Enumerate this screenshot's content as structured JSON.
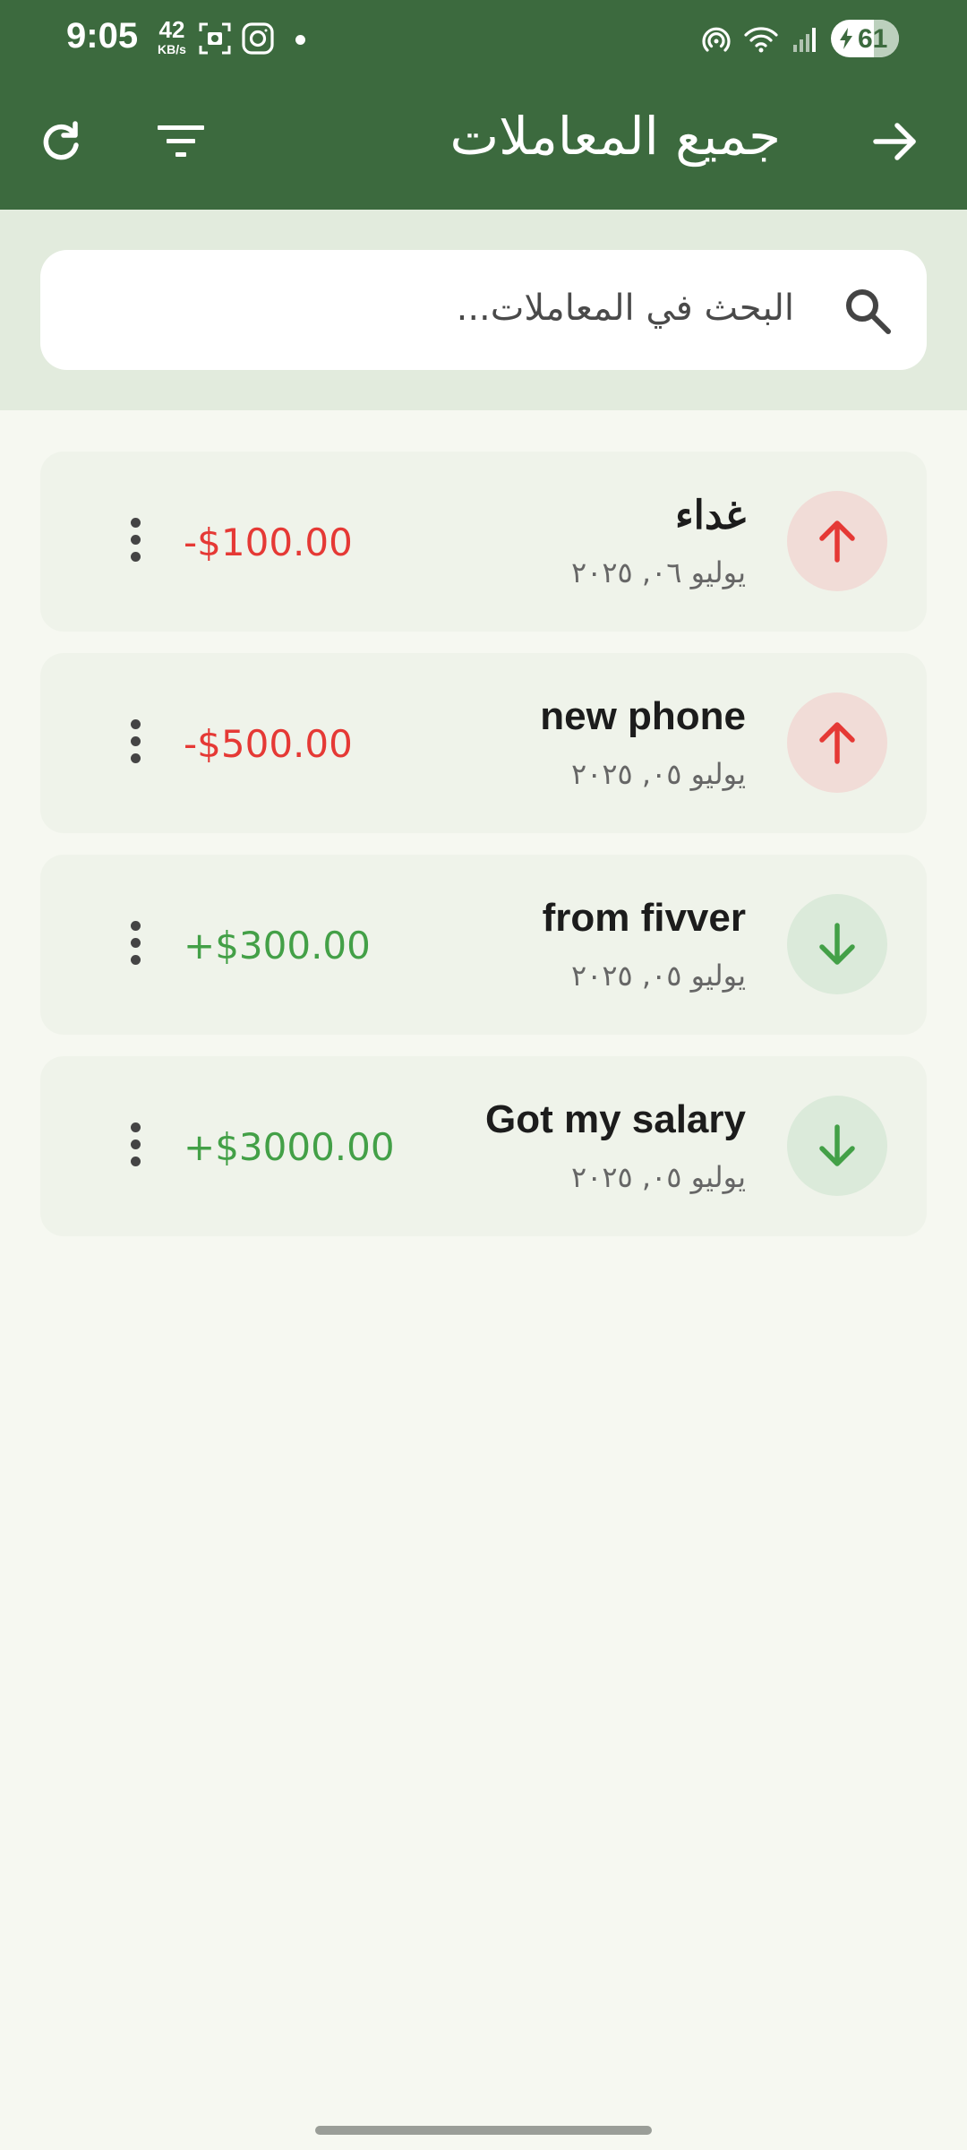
{
  "status_bar": {
    "time": "9:05",
    "net_speed_value": "42",
    "net_speed_unit": "KB/s",
    "battery_percent": "61"
  },
  "app_bar": {
    "title": "جميع المعاملات",
    "back_icon": "arrow-right-icon",
    "filter_icon": "filter-icon",
    "refresh_icon": "refresh-icon"
  },
  "search": {
    "placeholder": "البحث في المعاملات..."
  },
  "colors": {
    "header_green": "#3c6a3e",
    "expense_red": "#e53935",
    "income_green": "#43a047",
    "expense_circle_bg": "#f1dcd7",
    "income_circle_bg": "#dbeada"
  },
  "transactions": [
    {
      "title": "غداء",
      "date": "يوليو ٠٦, ٢٠٢٥",
      "amount": "-$100.00",
      "type": "expense"
    },
    {
      "title": "new phone",
      "date": "يوليو ٠٥, ٢٠٢٥",
      "amount": "-$500.00",
      "type": "expense"
    },
    {
      "title": "from fivver",
      "date": "يوليو ٠٥, ٢٠٢٥",
      "amount": "+$300.00",
      "type": "income"
    },
    {
      "title": "Got my salary",
      "date": "يوليو ٠٥, ٢٠٢٥",
      "amount": "+$3000.00",
      "type": "income"
    }
  ]
}
